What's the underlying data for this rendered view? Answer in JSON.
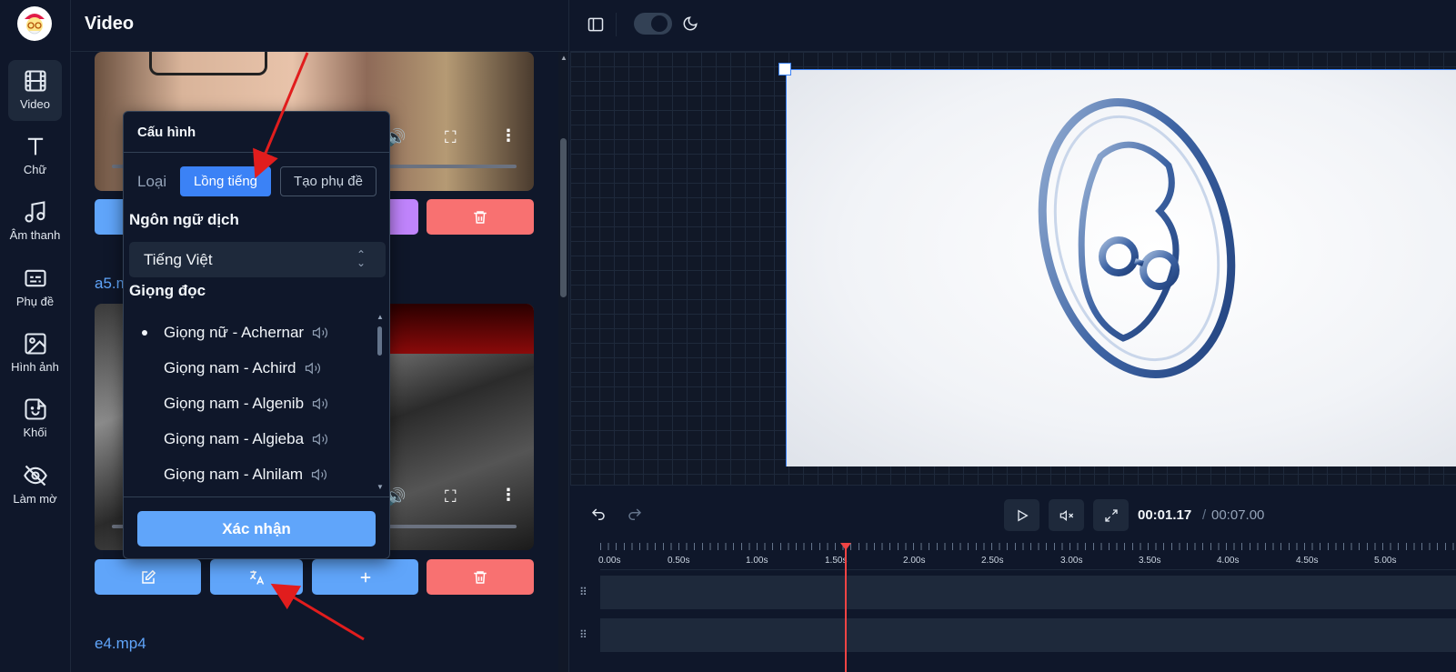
{
  "sidebar": {
    "items": [
      {
        "label": "Video",
        "icon": "film-icon",
        "active": true
      },
      {
        "label": "Chữ",
        "icon": "text-icon"
      },
      {
        "label": "Âm thanh",
        "icon": "music-icon"
      },
      {
        "label": "Phụ đề",
        "icon": "subtitles-icon"
      },
      {
        "label": "Hình ảnh",
        "icon": "image-icon"
      },
      {
        "label": "Khối",
        "icon": "sticker-icon"
      },
      {
        "label": "Làm mờ",
        "icon": "eye-off-icon"
      }
    ]
  },
  "panel": {
    "title": "Video",
    "files": [
      "a5.mp4",
      "e4.mp4"
    ],
    "file_partial": "a5.m"
  },
  "popover": {
    "title": "Cấu hình",
    "type_label": "Loại",
    "type_dub": "Lồng tiếng",
    "type_subtitle": "Tạo phụ đề",
    "lang_label": "Ngôn ngữ dịch",
    "lang_value": "Tiếng Việt",
    "voice_label": "Giọng đọc",
    "voices": [
      "Giọng nữ - Achernar",
      "Giọng nam - Achird",
      "Giọng nam - Algenib",
      "Giọng nam - Algieba",
      "Giọng nam - Alnilam"
    ],
    "selected_voice_index": 0,
    "confirm": "Xác nhận"
  },
  "player": {
    "current_time": "00:01.17",
    "separator": "/",
    "total_time": "00:07.00"
  },
  "timeline": {
    "ticks": [
      "0.00s",
      "0.50s",
      "1.00s",
      "1.50s",
      "2.00s",
      "2.50s",
      "3.00s",
      "3.50s",
      "4.00s",
      "4.50s",
      "5.00s"
    ]
  },
  "colors": {
    "accent": "#3b82f6",
    "edit_button": "#60a5fa",
    "delete_button": "#f87171",
    "add_button": "#c084fc",
    "playhead": "#ef4444",
    "annotation_arrow": "#e11d1d"
  }
}
